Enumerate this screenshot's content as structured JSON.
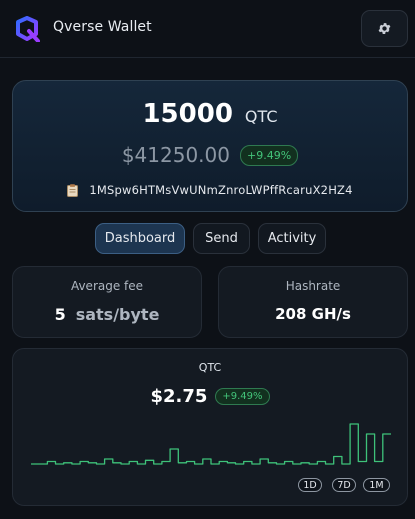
{
  "header": {
    "app_title": "Qverse Wallet",
    "logo_icon": "q-logo-icon",
    "settings_icon": "gear-icon"
  },
  "balance": {
    "amount": "15000",
    "unit": "QTC",
    "fiat": "$41250.00",
    "change": "+9.49%",
    "address": "1MSpw6HTMsVwUNmZnroLWPffRcaruX2HZ4",
    "copy_icon": "clipboard-icon"
  },
  "tabs": [
    {
      "label": "Dashboard",
      "active": true
    },
    {
      "label": "Send",
      "active": false
    },
    {
      "label": "Activity",
      "active": false
    }
  ],
  "stats": {
    "fee": {
      "label": "Average fee",
      "value": "5",
      "unit": "sats/byte"
    },
    "hashrate": {
      "label": "Hashrate",
      "value": "208 GH/s"
    }
  },
  "price": {
    "symbol": "QTC",
    "value": "$2.75",
    "change": "+9.49%",
    "ranges": [
      "1D",
      "7D",
      "1M"
    ],
    "sparkline": [
      1.0,
      1.0,
      1.1,
      1.0,
      1.05,
      1.0,
      1.1,
      1.05,
      1.0,
      1.2,
      1.05,
      1.0,
      1.1,
      1.0,
      1.15,
      1.0,
      1.1,
      1.6,
      1.05,
      1.1,
      1.0,
      1.2,
      1.0,
      1.1,
      1.05,
      1.0,
      1.1,
      1.0,
      1.2,
      1.05,
      1.0,
      1.1,
      1.0,
      1.05,
      1.0,
      1.1,
      1.0,
      1.3,
      1.0,
      2.6,
      1.1,
      2.2,
      1.1,
      2.2,
      2.2
    ],
    "colors": {
      "line": "#3ec27a",
      "badge": "#43c47a"
    }
  }
}
